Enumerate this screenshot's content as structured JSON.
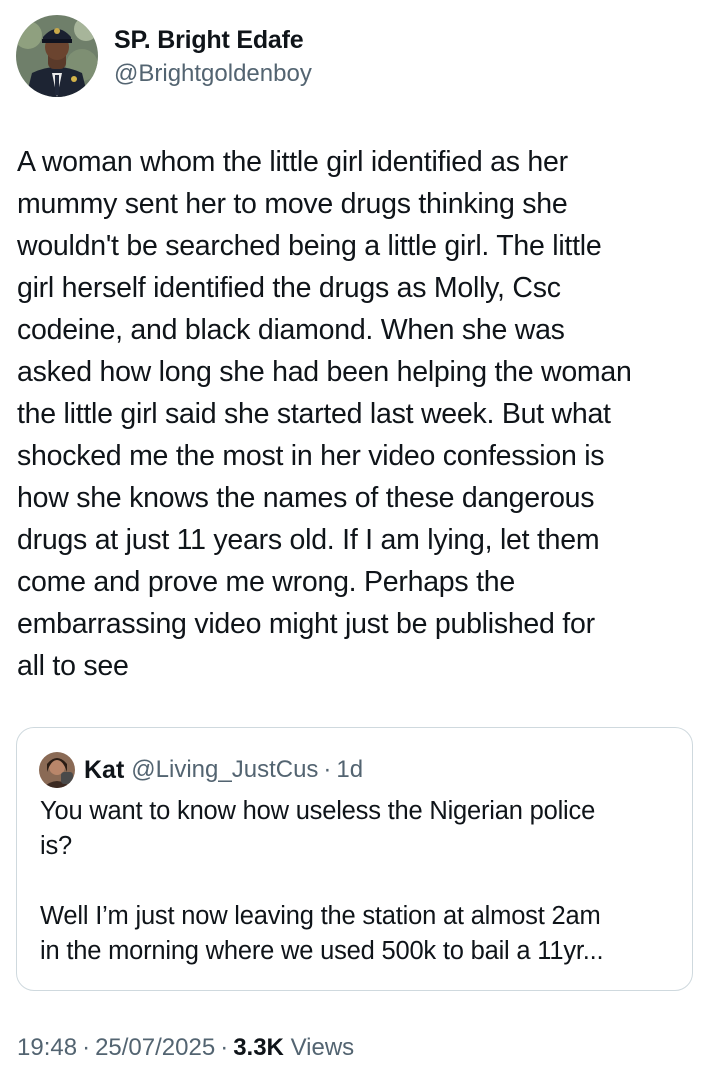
{
  "author": {
    "display_name": "SP. Bright Edafe",
    "handle": "@Brightgoldenboy",
    "avatar_icon": "police-officer-avatar"
  },
  "tweet": {
    "text_lines": [
      "A woman whom the little girl identified as her",
      "mummy sent her to move drugs thinking she",
      "wouldn't be searched being a little girl. The little",
      "girl herself identified the drugs as Molly, Csc",
      "codeine, and black diamond. When she was",
      "asked how long she had been helping the woman",
      "the little girl said she started last week. But what",
      "shocked me the most in her video confession is",
      "how she knows the names of these dangerous",
      "drugs at just 11 years old. If I am lying, let them",
      "come and prove me wrong. Perhaps the",
      "embarrassing video might just be published for",
      "all to see"
    ]
  },
  "quote": {
    "display_name": "Kat",
    "handle": "@Living_JustCus",
    "separator": "·",
    "time": "1d",
    "paragraph1_lines": [
      "You want to know how useless the Nigerian police",
      "is?"
    ],
    "paragraph2_lines": [
      "Well I’m just now leaving the station at almost 2am",
      "in the morning where we used 500k to bail a 11yr..."
    ]
  },
  "meta": {
    "time": "19:48",
    "separator": "·",
    "date": "25/07/2025",
    "views_count": "3.3K",
    "views_label": "Views"
  },
  "colors": {
    "text": "#0f1419",
    "secondary": "#536471",
    "border": "#cfd9de"
  }
}
